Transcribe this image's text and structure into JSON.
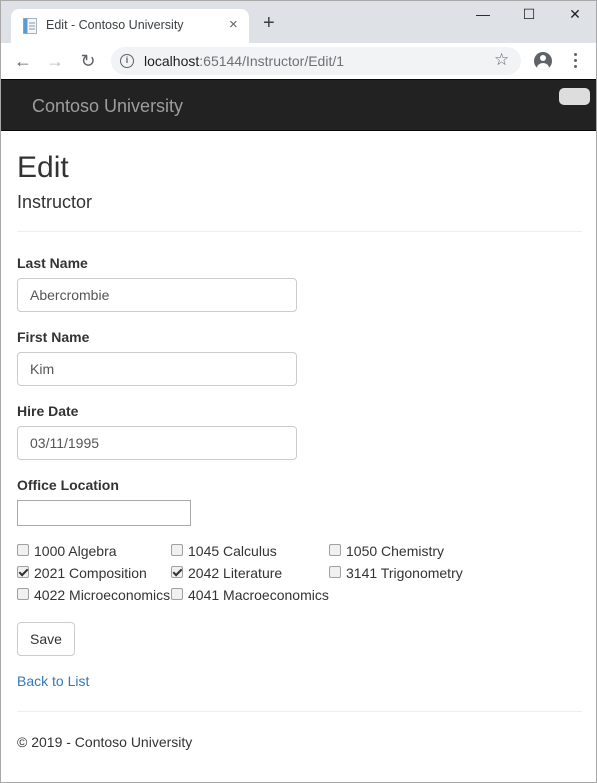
{
  "browser": {
    "tab_title": "Edit - Contoso University",
    "new_tab_symbol": "+",
    "url_host": "localhost",
    "url_rest": ":65144/Instructor/Edit/1",
    "icons": {
      "favicon": "document-icon",
      "close_tab": "×",
      "minimize": "—",
      "maximize": "☐",
      "close_window": "✕",
      "back": "←",
      "forward": "→",
      "reload": "↻",
      "info": "i",
      "bookmark": "☆"
    }
  },
  "navbar": {
    "brand": "Contoso University"
  },
  "page": {
    "title": "Edit",
    "subtitle": "Instructor"
  },
  "form": {
    "last_name": {
      "label": "Last Name",
      "value": "Abercrombie"
    },
    "first_name": {
      "label": "First Name",
      "value": "Kim"
    },
    "hire_date": {
      "label": "Hire Date",
      "value": "03/11/1995"
    },
    "office_location": {
      "label": "Office Location",
      "value": ""
    },
    "courses": [
      {
        "label": "1000 Algebra",
        "checked": false
      },
      {
        "label": "1045 Calculus",
        "checked": false
      },
      {
        "label": "1050 Chemistry",
        "checked": false
      },
      {
        "label": "2021 Composition",
        "checked": true
      },
      {
        "label": "2042 Literature",
        "checked": true
      },
      {
        "label": "3141 Trigonometry",
        "checked": false
      },
      {
        "label": "4022 Microeconomics",
        "checked": false
      },
      {
        "label": "4041 Macroeconomics",
        "checked": false
      }
    ],
    "save_label": "Save"
  },
  "links": {
    "back_to_list": "Back to List"
  },
  "footer": {
    "text": "© 2019 - Contoso University"
  },
  "colors": {
    "navbar_bg": "#222222",
    "brand_text": "#9d9d9d",
    "link": "#337ab7",
    "tabstrip_bg": "#dee1e6"
  }
}
